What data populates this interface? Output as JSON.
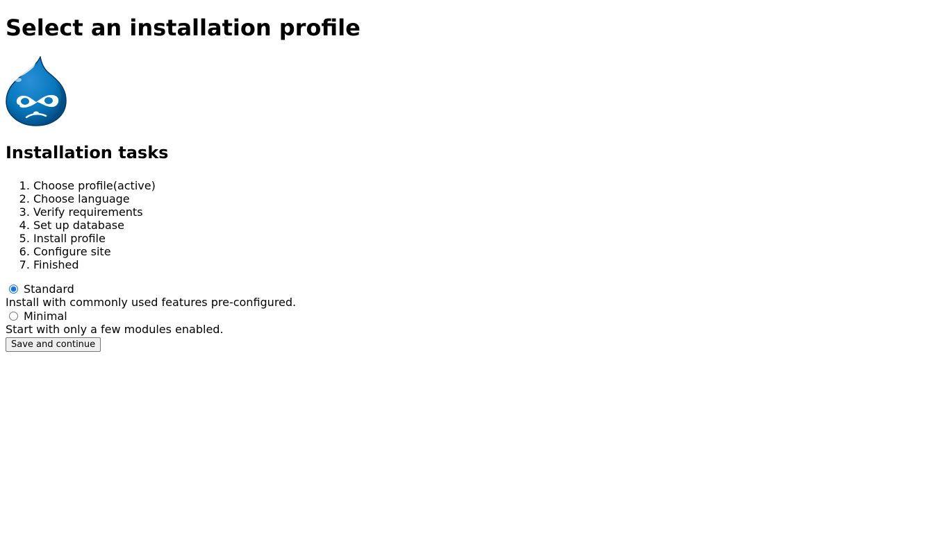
{
  "page": {
    "title": "Select an installation profile"
  },
  "logo": {
    "icon": "drupal-drop-logo",
    "colors": {
      "primary": "#0678BE",
      "dark": "#004A7F",
      "highlight": "#ffffff"
    }
  },
  "tasks": {
    "heading": "Installation tasks",
    "items": [
      "Choose profile(active)",
      "Choose language",
      "Verify requirements",
      "Set up database",
      "Install profile",
      "Configure site",
      "Finished"
    ]
  },
  "profiles": {
    "options": [
      {
        "label": "Standard",
        "description": "Install with commonly used features pre-configured.",
        "selected": true
      },
      {
        "label": "Minimal",
        "description": "Start with only a few modules enabled.",
        "selected": false
      }
    ]
  },
  "actions": {
    "submit_label": "Save and continue"
  }
}
